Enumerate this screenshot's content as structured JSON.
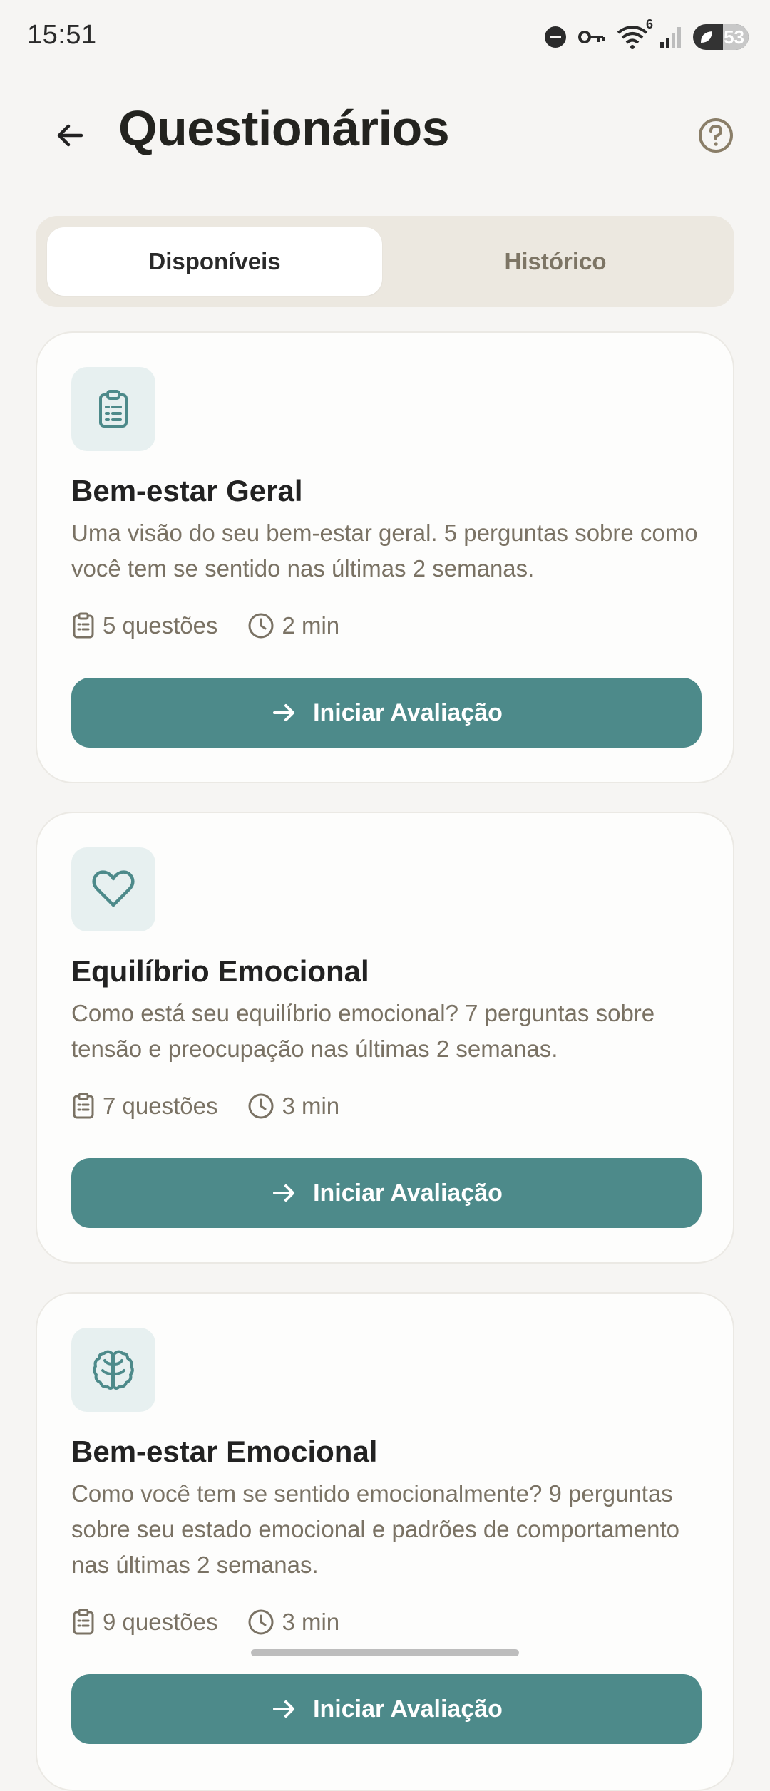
{
  "status_bar": {
    "time": "15:51",
    "battery": "53",
    "signal_label": "6"
  },
  "header": {
    "title": "Questionários"
  },
  "tabs": [
    {
      "label": "Disponíveis",
      "active": true
    },
    {
      "label": "Histórico",
      "active": false
    }
  ],
  "cards": [
    {
      "icon": "clipboard-list-icon",
      "title": "Bem-estar Geral",
      "description": "Uma visão do seu bem-estar geral. 5 perguntas sobre como você tem se sentido nas últimas 2 semanas.",
      "questions": "5 questões",
      "duration": "2 min",
      "button": "Iniciar Avaliação"
    },
    {
      "icon": "heart-icon",
      "title": "Equilíbrio Emocional",
      "description": "Como está seu equilíbrio emocional? 7 perguntas sobre tensão e preocupação nas últimas 2 semanas.",
      "questions": "7 questões",
      "duration": "3 min",
      "button": "Iniciar Avaliação"
    },
    {
      "icon": "brain-icon",
      "title": "Bem-estar Emocional",
      "description": "Como você tem se sentido emocionalmente? 9 perguntas sobre seu estado emocional e padrões de comportamento nas últimas 2 semanas.",
      "questions": "9 questões",
      "duration": "3 min",
      "button": "Iniciar Avaliação"
    }
  ],
  "colors": {
    "accent": "#4d8a8a",
    "background": "#f6f5f3",
    "muted_text": "#7a7264"
  }
}
